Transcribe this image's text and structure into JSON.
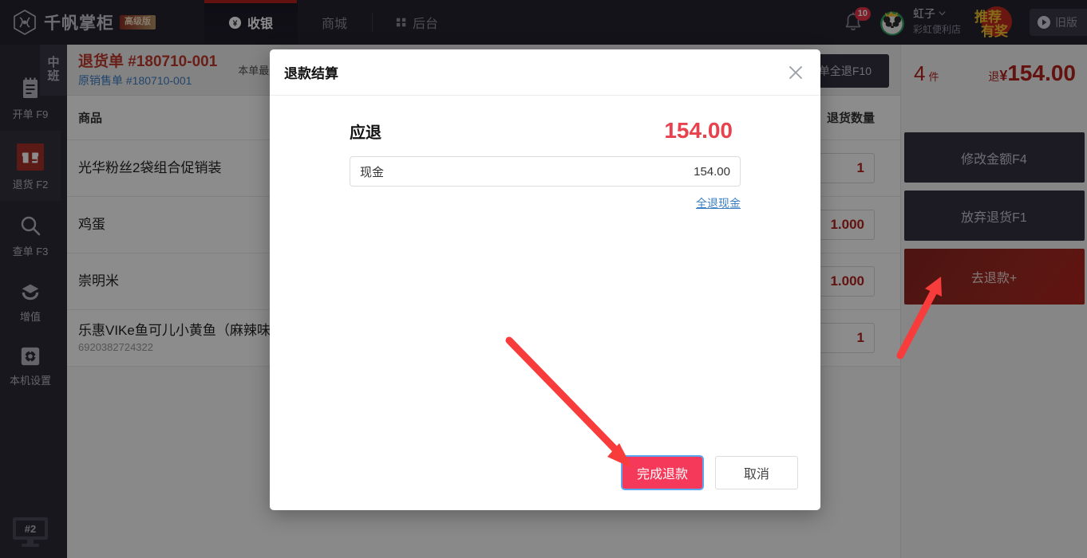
{
  "header": {
    "brand_name": "千帆掌柜",
    "brand_badge": "高级版",
    "nav": [
      {
        "label": "收银",
        "icon": "yen-circle-icon",
        "active": true
      },
      {
        "label": "商城",
        "icon": "",
        "active": false
      },
      {
        "label": "后台",
        "icon": "grid-icon",
        "active": false
      }
    ],
    "notifications": {
      "icon": "bell-icon",
      "count": "10"
    },
    "user": {
      "name": "虹子",
      "chevron": "chevron-down-icon",
      "shop": "彩虹便利店",
      "avatar": "panda-avatar"
    },
    "promo": {
      "line1": "推荐",
      "line2": "有奖"
    },
    "old_version": {
      "label": "旧版",
      "icon": "play-circle-icon"
    }
  },
  "sidebar": {
    "shift_tab": {
      "line1": "中",
      "line2": "班"
    },
    "items": [
      {
        "label": "开单 F9",
        "icon": "receipt-icon",
        "active": false
      },
      {
        "label": "退货 F2",
        "icon": "return-box-icon",
        "active": true
      },
      {
        "label": "查单 F3",
        "icon": "search-icon",
        "active": false
      },
      {
        "label": "增值",
        "icon": "layers-icon",
        "active": false
      },
      {
        "label": "本机设置",
        "icon": "gear-icon",
        "active": false
      }
    ],
    "device": {
      "label": "#2",
      "icon": "monitor-icon"
    }
  },
  "order": {
    "return_no": "退货单 #180710-001",
    "source_no": "原销售单 #180710-001",
    "hint": "本单最多可",
    "all_return_button": "单全退F10",
    "columns": {
      "product": "商品",
      "quantity": "退货数量"
    },
    "rows": [
      {
        "name": "光华粉丝2袋组合促销装",
        "code": "",
        "qty": "1"
      },
      {
        "name": "鸡蛋",
        "code": "",
        "qty": "1.000"
      },
      {
        "name": "崇明米",
        "code": "",
        "qty": "1.000"
      },
      {
        "name": "乐惠VIKe鱼可儿小黄鱼（麻辣味）",
        "code": "6920382724322",
        "qty": "1"
      }
    ]
  },
  "right_panel": {
    "count_value": "4",
    "count_unit": "件",
    "amount_label": "退",
    "amount_yen": "¥",
    "amount_value": "154.00",
    "buttons": [
      {
        "label": "修改金额F4",
        "style": "dark"
      },
      {
        "label": "放弃退货F1",
        "style": "dark"
      },
      {
        "label": "去退款+",
        "style": "danger"
      }
    ]
  },
  "modal": {
    "title": "退款结算",
    "close_icon": "close-icon",
    "due_label": "应退",
    "due_amount": "154.00",
    "payment": {
      "method": "现金",
      "value": "154.00"
    },
    "full_refund_link": "全退现金",
    "confirm_button": "完成退款",
    "cancel_button": "取消"
  },
  "colors": {
    "brand_red": "#b3241e",
    "accent_pink": "#f5395a",
    "link_blue": "#3c7fc4",
    "header_bg": "#262430",
    "annotation_red": "#f83b3b"
  }
}
